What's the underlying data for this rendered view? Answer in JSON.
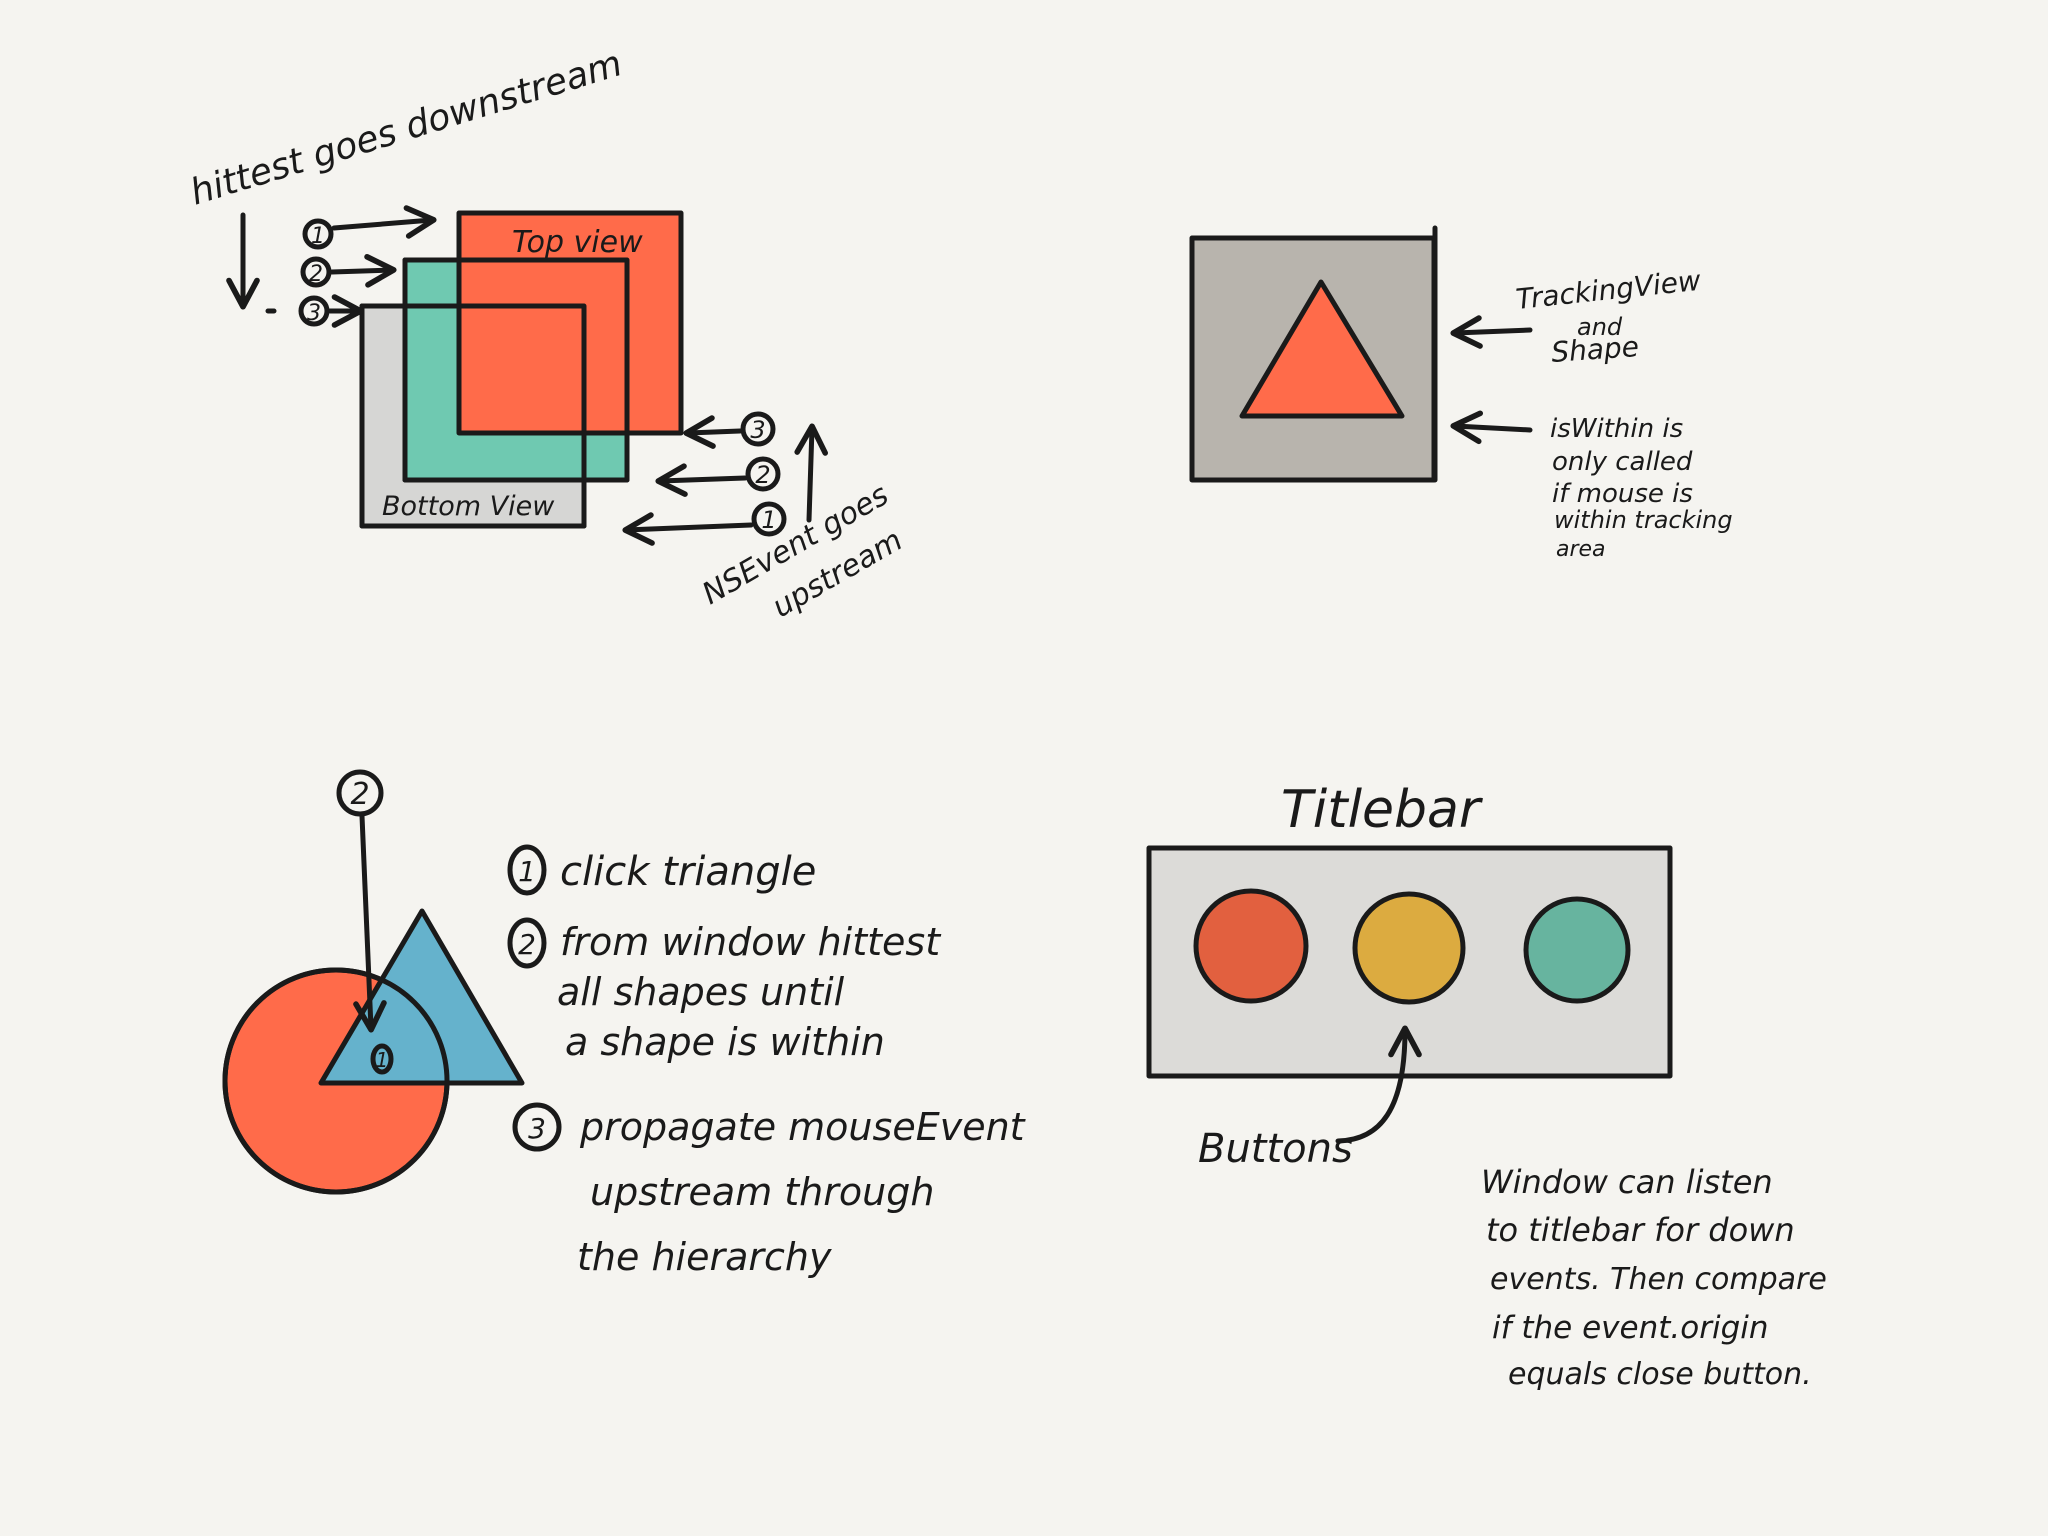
{
  "colors": {
    "background": "#f5f4f0",
    "red": "#ff6b4a",
    "teal": "#6fc9b1",
    "gray": "#d6d6d4",
    "tracking_gray": "#b8b4ad",
    "blue": "#65b2cc",
    "button_red": "#e2603f",
    "button_yellow": "#dcab40",
    "button_teal": "#67b49f",
    "ink": "#1a1a1a"
  },
  "panel_views": {
    "hittest_label": "hittest goes downstream",
    "top_view_label": "Top view",
    "bottom_view_label": "Bottom View",
    "left_markers": [
      "1",
      "2",
      "3"
    ],
    "right_markers": [
      "3",
      "2",
      "1"
    ],
    "nsevent_label_line1": "NSEvent goes",
    "nsevent_label_line2": "upstream"
  },
  "panel_tracking": {
    "label1_line1": "TrackingView",
    "label1_line2": "and",
    "label1_line3": "Shape",
    "label2_lines": [
      "isWithin is",
      "only called",
      "if mouse is",
      "within tracking",
      "area"
    ]
  },
  "panel_click": {
    "marker_top": "2",
    "marker_inside": "1",
    "steps": [
      {
        "num": "1",
        "lines": [
          "click triangle"
        ]
      },
      {
        "num": "2",
        "lines": [
          "from window hittest",
          "all shapes until",
          "a shape is within"
        ]
      },
      {
        "num": "3",
        "lines": [
          "propagate mouseEvent",
          "upstream through",
          "the hierarchy"
        ]
      }
    ]
  },
  "panel_titlebar": {
    "title": "Titlebar",
    "buttons_label": "Buttons",
    "note_lines": [
      "Window can listen",
      "to titlebar for down",
      "events. Then compare",
      "if the event.origin",
      "equals close button."
    ]
  }
}
